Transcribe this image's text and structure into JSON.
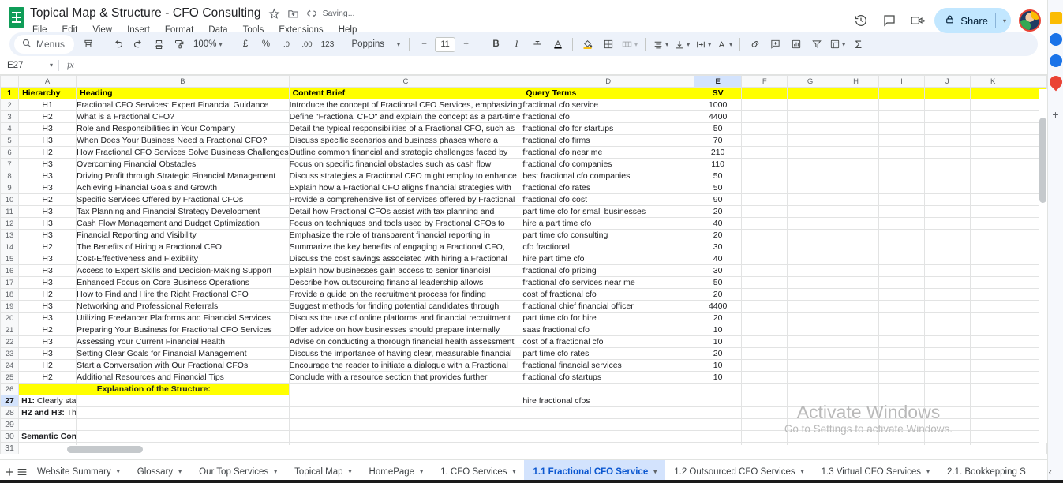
{
  "titlebar": {
    "doc_title": "Topical Map & Structure -  CFO Consulting",
    "saving_text": "Saving...",
    "star_icon": "star-icon",
    "move_icon": "move-to-folder-icon",
    "cloud_icon": "document-status-icon",
    "menus": [
      "File",
      "Edit",
      "View",
      "Insert",
      "Format",
      "Data",
      "Tools",
      "Extensions",
      "Help"
    ],
    "history_icon": "version-history-icon",
    "comment_icon": "comment-icon",
    "meet_icon": "meet-camera-icon",
    "share_label": "Share",
    "share_lock_icon": "lock-icon",
    "avatar_name": "user-avatar"
  },
  "toolbar": {
    "menus_label": "Menus",
    "search_icon": "search-icon",
    "items": [
      {
        "name": "paint-format-icon",
        "label": "⌸"
      },
      {
        "name": "undo-icon",
        "label": "↶"
      },
      {
        "name": "redo-icon",
        "label": "↷"
      },
      {
        "name": "print-icon",
        "label": "⎙"
      },
      {
        "name": "paint-roller-icon",
        "label": "✒"
      }
    ],
    "zoom_value": "100%",
    "currency_label": "£",
    "percent_label": "%",
    "decimal_dec_label": ".0",
    "decimal_inc_label": ".00",
    "format_123_label": "123",
    "font_family": "Poppins",
    "font_size": "11",
    "decrease_label": "−",
    "increase_label": "+",
    "bold_label": "B",
    "italic_label": "I",
    "strike_label": "S",
    "text_color_label": "A",
    "fill_icon": "fill-color-icon",
    "borders_icon": "borders-icon",
    "merge_icon": "merge-cells-icon",
    "halign_icon": "horizontal-align-icon",
    "valign_icon": "vertical-align-icon",
    "wrap_icon": "text-wrap-icon",
    "rotate_icon": "text-rotation-icon",
    "link_icon": "insert-link-icon",
    "comment_icon": "insert-comment-icon",
    "chart_icon": "insert-chart-icon",
    "filter_icon": "create-filter-icon",
    "functions_icon": "functions-icon",
    "sigma_label": "Σ"
  },
  "formula_bar": {
    "name_box": "E27",
    "fx_label": "fx",
    "formula_value": ""
  },
  "grid": {
    "column_headers": [
      "A",
      "B",
      "C",
      "D",
      "E",
      "F",
      "G",
      "H",
      "I",
      "J",
      "K",
      ""
    ],
    "selected_column": "E",
    "selected_row": "27",
    "selected_cell": "E27",
    "header_fill": "#ffff00",
    "headers": [
      "Hierarchy",
      "Heading",
      "Content Brief",
      "Query Terms",
      "SV"
    ],
    "rows": [
      {
        "n": "2",
        "hierarchy": "H1",
        "heading": "Fractional CFO Services: Expert Financial Guidance",
        "brief": "Introduce the concept of Fractional CFO Services, emphasizing",
        "query": "fractional cfo service",
        "sv": "1000"
      },
      {
        "n": "3",
        "hierarchy": "H2",
        "heading": "What is a Fractional CFO?",
        "brief": "Define \"Fractional CFO\" and explain the concept as a part-time",
        "query": "fractional cfo",
        "sv": "4400"
      },
      {
        "n": "4",
        "hierarchy": "H3",
        "heading": "Role and Responsibilities in Your Company",
        "brief": "Detail the typical responsibilities of a Fractional CFO, such as",
        "query": "fractional cfo for startups",
        "sv": "50"
      },
      {
        "n": "5",
        "hierarchy": "H3",
        "heading": "When Does Your Business Need a Fractional CFO?",
        "brief": "Discuss specific scenarios and business phases where a",
        "query": "fractional cfo firms",
        "sv": "70"
      },
      {
        "n": "6",
        "hierarchy": "H2",
        "heading": "How Fractional CFO Services Solve Business Challenges",
        "brief": "Outline common financial and strategic challenges faced by",
        "query": "fractional cfo near me",
        "sv": "210"
      },
      {
        "n": "7",
        "hierarchy": "H3",
        "heading": "Overcoming Financial Obstacles",
        "brief": "Focus on specific financial obstacles such as cash flow",
        "query": "fractional cfo companies",
        "sv": "110"
      },
      {
        "n": "8",
        "hierarchy": "H3",
        "heading": "Driving Profit through Strategic Financial Management",
        "brief": "Discuss strategies a Fractional CFO might employ to enhance",
        "query": "best fractional cfo companies",
        "sv": "50"
      },
      {
        "n": "9",
        "hierarchy": "H3",
        "heading": "Achieving Financial Goals and Growth",
        "brief": "Explain how a Fractional CFO aligns financial strategies with",
        "query": "fractional cfo rates",
        "sv": "50"
      },
      {
        "n": "10",
        "hierarchy": "H2",
        "heading": "Specific Services Offered by Fractional CFOs",
        "brief": "Provide a comprehensive list of services offered by Fractional",
        "query": "fractional cfo cost",
        "sv": "90"
      },
      {
        "n": "11",
        "hierarchy": "H3",
        "heading": "Tax Planning and Financial Strategy Development",
        "brief": "Detail how Fractional CFOs assist with tax planning and",
        "query": "part time cfo for small businesses",
        "sv": "20"
      },
      {
        "n": "12",
        "hierarchy": "H3",
        "heading": "Cash Flow Management and Budget Optimization",
        "brief": "Focus on techniques and tools used by Fractional CFOs to",
        "query": "hire a part time cfo",
        "sv": "40"
      },
      {
        "n": "13",
        "hierarchy": "H3",
        "heading": "Financial Reporting and Visibility",
        "brief": "Emphasize the role of transparent financial reporting in",
        "query": "part time cfo consulting",
        "sv": "20"
      },
      {
        "n": "14",
        "hierarchy": "H2",
        "heading": "The Benefits of Hiring a Fractional CFO",
        "brief": "Summarize the key benefits of engaging a Fractional CFO,",
        "query": "cfo fractional",
        "sv": "30"
      },
      {
        "n": "15",
        "hierarchy": "H3",
        "heading": "Cost-Effectiveness and Flexibility",
        "brief": "Discuss the cost savings associated with hiring a Fractional",
        "query": "hire part time cfo",
        "sv": "40"
      },
      {
        "n": "16",
        "hierarchy": "H3",
        "heading": "Access to Expert Skills and Decision-Making Support",
        "brief": "Explain how businesses gain access to senior financial",
        "query": "fractional cfo pricing",
        "sv": "30"
      },
      {
        "n": "17",
        "hierarchy": "H3",
        "heading": "Enhanced Focus on Core Business Operations",
        "brief": "Describe how outsourcing financial leadership allows",
        "query": "fractional cfo services near me",
        "sv": "50"
      },
      {
        "n": "18",
        "hierarchy": "H2",
        "heading": "How to Find and Hire the Right Fractional CFO",
        "brief": "Provide a guide on the recruitment process for finding",
        "query": "cost of fractional cfo",
        "sv": "20"
      },
      {
        "n": "19",
        "hierarchy": "H3",
        "heading": "Networking and Professional Referrals",
        "brief": "Suggest methods for finding potential candidates through",
        "query": "fractional chief financial officer",
        "sv": "4400"
      },
      {
        "n": "20",
        "hierarchy": "H3",
        "heading": "Utilizing Freelancer Platforms and Financial Services",
        "brief": "Discuss the use of online platforms and financial recruitment",
        "query": "part time cfo for hire",
        "sv": "20"
      },
      {
        "n": "21",
        "hierarchy": "H2",
        "heading": "Preparing Your Business for Fractional CFO Services",
        "brief": "Offer advice on how businesses should prepare internally",
        "query": "saas fractional cfo",
        "sv": "10"
      },
      {
        "n": "22",
        "hierarchy": "H3",
        "heading": "Assessing Your Current Financial Health",
        "brief": "Advise on conducting a thorough financial health assessment",
        "query": "cost of a fractional cfo",
        "sv": "10"
      },
      {
        "n": "23",
        "hierarchy": "H3",
        "heading": "Setting Clear Goals for Financial Management",
        "brief": "Discuss the importance of having clear, measurable financial",
        "query": "part time cfo rates",
        "sv": "20"
      },
      {
        "n": "24",
        "hierarchy": "H2",
        "heading": "Start a Conversation with Our Fractional CFOs",
        "brief": "Encourage the reader to initiate a dialogue with a Fractional",
        "query": "fractional financial services",
        "sv": "10"
      },
      {
        "n": "25",
        "hierarchy": "H2",
        "heading": "Additional Resources and Financial Tips",
        "brief": "Conclude with a resource section that provides further",
        "query": "fractional cfo startups",
        "sv": "10"
      }
    ],
    "explanation_title_row": "26",
    "explanation_title": "Explanation of the Structure:",
    "notes": [
      {
        "n": "27",
        "label": "H1:",
        "text": " Clearly states the main topic, ensuring it is both relevant and prominently positioned as the central theme of the",
        "tail": "hire fractional cfos"
      },
      {
        "n": "28",
        "label": "H2 and H3:",
        "text": " These headings are strategically structured to cover all aspects of Fractional CFO services comprehensively. Starting with a basic understanding, moving into specific services, detailing benefits, and finally guiding on hiring practices, ensures a logical flow",
        "tail": ""
      },
      {
        "n": "29",
        "label": "",
        "text": "",
        "tail": ""
      },
      {
        "n": "30",
        "label": "Semantic Connectivity:",
        "text": " Each section is linked semantically, enhancing the topical authority by creating a dense network of related terms and concepts. This setup not only aids SEO but also improves the user experience by providing a clear, logical progression throu",
        "tail": ""
      },
      {
        "n": "31",
        "label": "",
        "text": "",
        "tail": ""
      }
    ],
    "watermark_line1": "Activate Windows",
    "watermark_line2": "Go to Settings to activate Windows."
  },
  "sheet_tabs": {
    "add_icon": "add-sheet-icon",
    "all_sheets_icon": "all-sheets-icon",
    "tabs": [
      {
        "label": "Website Summary",
        "active": false
      },
      {
        "label": "Glossary",
        "active": false
      },
      {
        "label": "Our Top Services",
        "active": false
      },
      {
        "label": "Topical Map",
        "active": false
      },
      {
        "label": "HomePage",
        "active": false
      },
      {
        "label": "1. CFO Services",
        "active": false
      },
      {
        "label": "1.1 Fractional CFO Service",
        "active": true
      },
      {
        "label": "1.2 Outsourced CFO Services",
        "active": false
      },
      {
        "label": "1.3 Virtual CFO Services",
        "active": false
      },
      {
        "label": "2.1. Bookkepping S",
        "active": false
      }
    ],
    "prev_icon": "previous-sheet-icon",
    "next_icon": "next-sheet-icon"
  },
  "side_rail": {
    "icons": [
      {
        "name": "google-keep-icon",
        "color": "#fbbc04",
        "glyph": "▮"
      },
      {
        "name": "google-tasks-icon",
        "color": "#1a73e8",
        "glyph": "●"
      },
      {
        "name": "google-contacts-icon",
        "color": "#1a73e8",
        "glyph": "●"
      },
      {
        "name": "google-maps-icon",
        "color": "#ea4335",
        "glyph": "●"
      }
    ],
    "add_on_label": "+"
  }
}
